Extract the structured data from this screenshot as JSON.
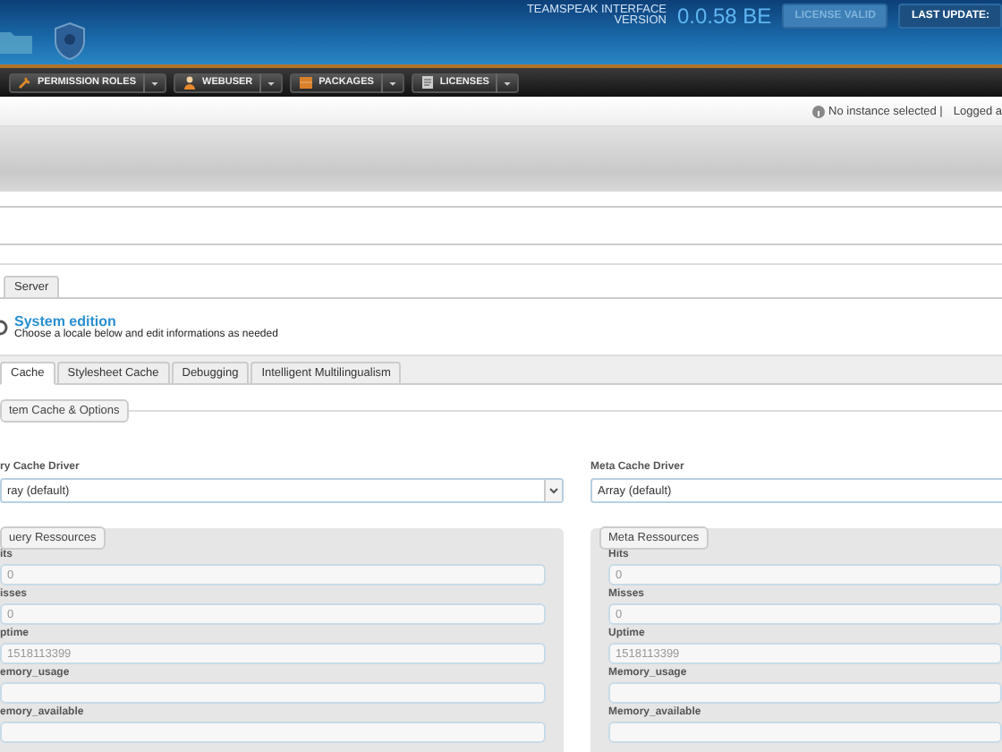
{
  "header": {
    "version_label": [
      "TEAMSPEAK INTERFACE",
      "VERSION"
    ],
    "version": "0.0.58 BE",
    "buttons": [
      {
        "label": "LICENSE VALID",
        "disabled": true
      },
      {
        "label": "LAST UPDATE:",
        "disabled": false
      }
    ]
  },
  "nav": [
    {
      "label": "PERMISSION ROLES",
      "kind": "wrench"
    },
    {
      "label": "WEBUSER",
      "kind": "user"
    },
    {
      "label": "PACKAGES",
      "kind": "package"
    },
    {
      "label": "LICENSES",
      "kind": "document"
    }
  ],
  "info_bar": {
    "status": "No instance selected |",
    "user": "Logged a"
  },
  "page_tabs": [
    {
      "label": "Server",
      "selected": false
    }
  ],
  "heading": {
    "title": "System edition",
    "subtitle": "Choose a locale below and edit informations as needed"
  },
  "tabs": [
    {
      "label": "Cache",
      "selected": true
    },
    {
      "label": "Stylesheet Cache",
      "selected": false
    },
    {
      "label": "Debugging",
      "selected": false
    },
    {
      "label": "Intelligent Multilingualism",
      "selected": false
    }
  ],
  "fieldset_legend": "tem Cache & Options",
  "columns": [
    {
      "driver_label": "ry Cache Driver",
      "driver_value": "ray (default)",
      "has_caret": true,
      "resources_legend": "uery Ressources",
      "fields": [
        {
          "label": "its",
          "value": "0"
        },
        {
          "label": "isses",
          "value": "0"
        },
        {
          "label": "ptime",
          "value": "1518113399"
        },
        {
          "label": "emory_usage"
        },
        {
          "label": "emory_available"
        }
      ]
    },
    {
      "driver_label": "Meta Cache Driver",
      "driver_value": "Array (default)",
      "has_caret": false,
      "resources_legend": "Meta Ressources",
      "fields": [
        {
          "label": "Hits",
          "value": "0"
        },
        {
          "label": "Misses",
          "value": "0"
        },
        {
          "label": "Uptime",
          "value": "1518113399"
        },
        {
          "label": "Memory_usage"
        },
        {
          "label": "Memory_available"
        }
      ]
    }
  ]
}
